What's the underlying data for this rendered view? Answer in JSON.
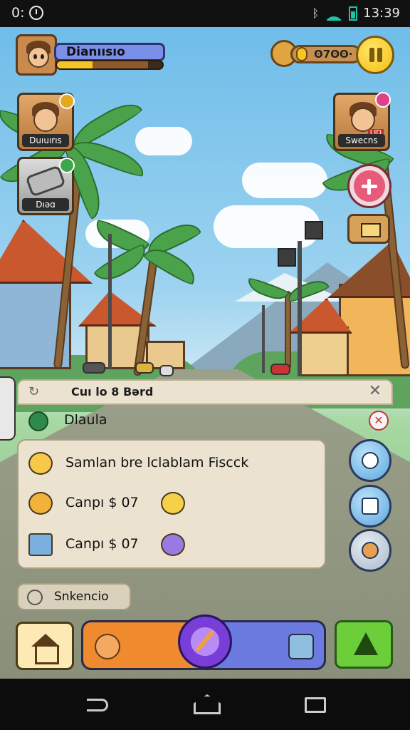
{
  "status_bar": {
    "left_text": "0:",
    "time": "13:39",
    "icons": [
      "alarm-icon",
      "bluetooth-icon",
      "wifi-icon",
      "battery-icon"
    ]
  },
  "hud": {
    "player_name": "Dianıısıo",
    "xp_progress": 0.34,
    "currency_value": "ʘ7ʘʘ·",
    "left_cards": [
      {
        "label": "Duıuırıs"
      },
      {
        "label": "Dıəɑ"
      }
    ],
    "right_card": {
      "label": "Swecns",
      "tag": "LID"
    }
  },
  "panel": {
    "title": "Cuı lo 8 Bərd",
    "info_label": "Dlaula"
  },
  "chat": [
    {
      "text": "Samlan bre lclablam Fisсck"
    },
    {
      "text": "Canpı $ 07"
    },
    {
      "text": "Canpı $ 07"
    }
  ],
  "hint": {
    "label": "Snkencio"
  },
  "colors": {
    "accent_orange": "#f08a2e",
    "accent_blue": "#6b7be0",
    "accent_green": "#6ccf3a",
    "panel_bg": "#ebe3cf"
  }
}
